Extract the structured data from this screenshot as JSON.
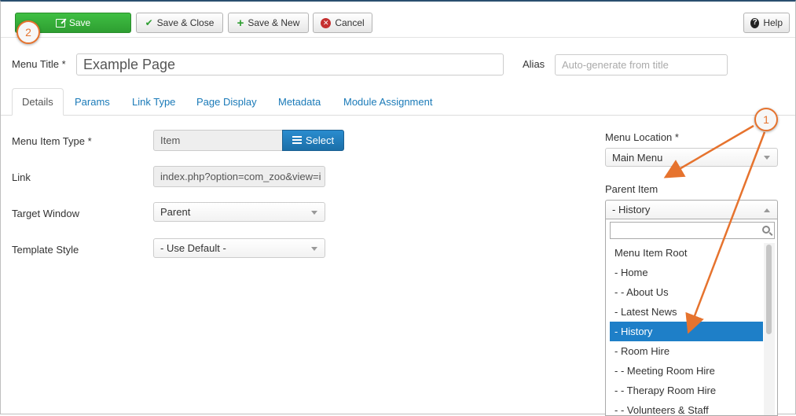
{
  "toolbar": {
    "save_label": "Save",
    "save_close_label": "Save & Close",
    "save_new_label": "Save & New",
    "cancel_label": "Cancel",
    "help_label": "Help"
  },
  "callouts": {
    "first": "1",
    "second": "2"
  },
  "title_row": {
    "menu_title_label": "Menu Title *",
    "menu_title_value": "Example Page",
    "alias_label": "Alias",
    "alias_placeholder": "Auto-generate from title"
  },
  "tabs": [
    {
      "label": "Details",
      "active": true
    },
    {
      "label": "Params"
    },
    {
      "label": "Link Type"
    },
    {
      "label": "Page Display"
    },
    {
      "label": "Metadata"
    },
    {
      "label": "Module Assignment"
    }
  ],
  "details": {
    "menu_item_type_label": "Menu Item Type *",
    "menu_item_type_value": "Item",
    "select_label": "Select",
    "link_label": "Link",
    "link_value": "index.php?option=com_zoo&view=i",
    "target_window_label": "Target Window",
    "target_window_value": "Parent",
    "template_style_label": "Template Style",
    "template_style_value": "- Use Default -"
  },
  "sidebar": {
    "menu_location_label": "Menu Location *",
    "menu_location_value": "Main Menu",
    "parent_item_label": "Parent Item",
    "parent_item_value": "- History",
    "parent_options": [
      "Menu Item Root",
      "- Home",
      "- - About Us",
      "- Latest News",
      "- History",
      "- Room Hire",
      "- - Meeting Room Hire",
      "- - Therapy Room Hire",
      "- - Volunteers & Staff"
    ],
    "selected_option": "- History"
  },
  "colors": {
    "save_green": "#34a937",
    "link_blue": "#1a7ab8",
    "selected_blue": "#1e7fc8",
    "callout_orange": "#e6732e"
  }
}
